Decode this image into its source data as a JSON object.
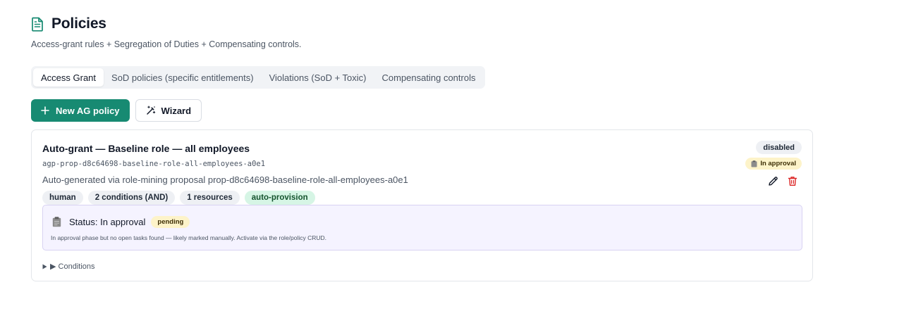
{
  "header": {
    "title": "Policies",
    "subtitle": "Access-grant rules + Segregation of Duties + Compensating controls.",
    "icon": "document-icon"
  },
  "tabs": [
    {
      "label": "Access Grant",
      "active": true
    },
    {
      "label": "SoD policies (specific entitlements)",
      "active": false
    },
    {
      "label": "Violations (SoD + Toxic)",
      "active": false
    },
    {
      "label": "Compensating controls",
      "active": false
    }
  ],
  "toolbar": {
    "new_label": "New AG policy",
    "wizard_label": "Wizard"
  },
  "policy": {
    "title": "Auto-grant — Baseline role — all employees",
    "id": "agp-prop-d8c64698-baseline-role-all-employees-a0e1",
    "description": "Auto-generated via role-mining proposal prop-d8c64698-baseline-role-all-employees-a0e1",
    "chips": [
      "human",
      "2 conditions (AND)",
      "1 resources",
      "auto-provision"
    ],
    "state_badge": "disabled",
    "approval_badge": "In approval",
    "status": {
      "label": "Status: In approval",
      "badge": "pending",
      "note": "In approval phase but no open tasks found — likely marked manually. Activate via the role/policy CRUD."
    },
    "conditions_label": "▶ Conditions"
  },
  "colors": {
    "primary": "#178a72",
    "delete": "#dc2626",
    "status_bg": "#f5f3ff",
    "pending_bg": "#fdf3c9",
    "green_chip_bg": "#d6f5e5"
  }
}
